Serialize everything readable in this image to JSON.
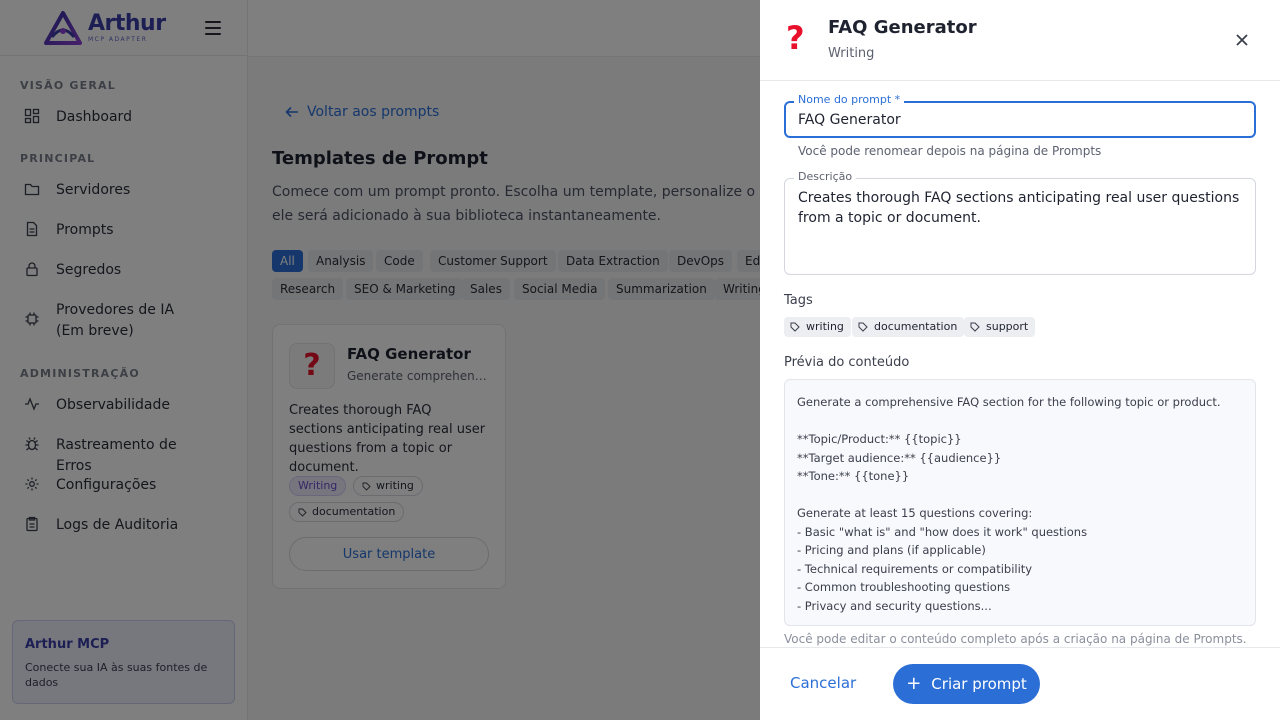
{
  "brand": {
    "name": "Arthur",
    "sub": "MCP ADAPTER"
  },
  "sidebar": {
    "sections": [
      "VISÃO GERAL",
      "PRINCIPAL",
      "ADMINISTRAÇÃO"
    ],
    "items": [
      {
        "label": "Dashboard",
        "icon": "dashboard-icon"
      },
      {
        "label": "Servidores",
        "icon": "folder-icon"
      },
      {
        "label": "Prompts",
        "icon": "document-icon"
      },
      {
        "label": "Segredos",
        "icon": "lock-icon"
      },
      {
        "label": "Provedores de IA (Em breve)",
        "icon": "chip-icon"
      },
      {
        "label": "Observabilidade",
        "icon": "activity-icon"
      },
      {
        "label": "Rastreamento de Erros",
        "icon": "bug-icon"
      },
      {
        "label": "Configurações",
        "icon": "gear-icon"
      },
      {
        "label": "Logs de Auditoria",
        "icon": "clipboard-icon"
      }
    ],
    "promo": {
      "title": "Arthur MCP",
      "text": "Conecte sua IA às suas fontes de dados"
    }
  },
  "main": {
    "back_label": "Voltar aos prompts",
    "title": "Templates de Prompt",
    "description": "Comece com um prompt pronto. Escolha um template, personalize o nome e ele será adicionado à sua biblioteca instantaneamente.",
    "filters": [
      "All",
      "Analysis",
      "Code",
      "Customer Support",
      "Data Extraction",
      "DevOps",
      "Ed",
      "Research",
      "SEO & Marketing",
      "Sales",
      "Social Media",
      "Summarization",
      "Writing"
    ],
    "active_filter": "All",
    "card": {
      "title": "FAQ Generator",
      "subtitle": "Generate comprehensive FAQ sections",
      "description": "Creates thorough FAQ sections anticipating real user questions from a topic or document.",
      "category": "Writing",
      "tags": [
        "writing",
        "documentation"
      ],
      "button": "Usar template"
    }
  },
  "drawer": {
    "title": "FAQ Generator",
    "subtitle": "Writing",
    "name_label": "Nome do prompt *",
    "name_value": "FAQ Generator",
    "name_helper": "Você pode renomear depois na página de Prompts",
    "desc_label": "Descrição",
    "desc_value": "Creates thorough FAQ sections anticipating real user questions from a topic or document.",
    "tags_label": "Tags",
    "tags": [
      "writing",
      "documentation",
      "support"
    ],
    "preview_label": "Prévia do conteúdo",
    "preview_lines": [
      "Generate a comprehensive FAQ section for the following topic or product.",
      "",
      "**Topic/Product:** {{topic}}",
      "**Target audience:** {{audience}}",
      "**Tone:** {{tone}}",
      "",
      "Generate at least 15 questions covering:",
      "- Basic \"what is\" and \"how does it work\" questions",
      "- Pricing and plans (if applicable)",
      "- Technical requirements or compatibility",
      "- Common troubleshooting questions",
      "- Privacy and security questions..."
    ],
    "preview_helper": "Você pode editar o conteúdo completo após a criação na página de Prompts.",
    "cancel": "Cancelar",
    "create": "Criar prompt"
  },
  "colors": {
    "accent": "#2b6fd6",
    "brand": "#3b3fa8",
    "question_mark": "#e8102a",
    "category_badge": "#6a4fd0"
  }
}
